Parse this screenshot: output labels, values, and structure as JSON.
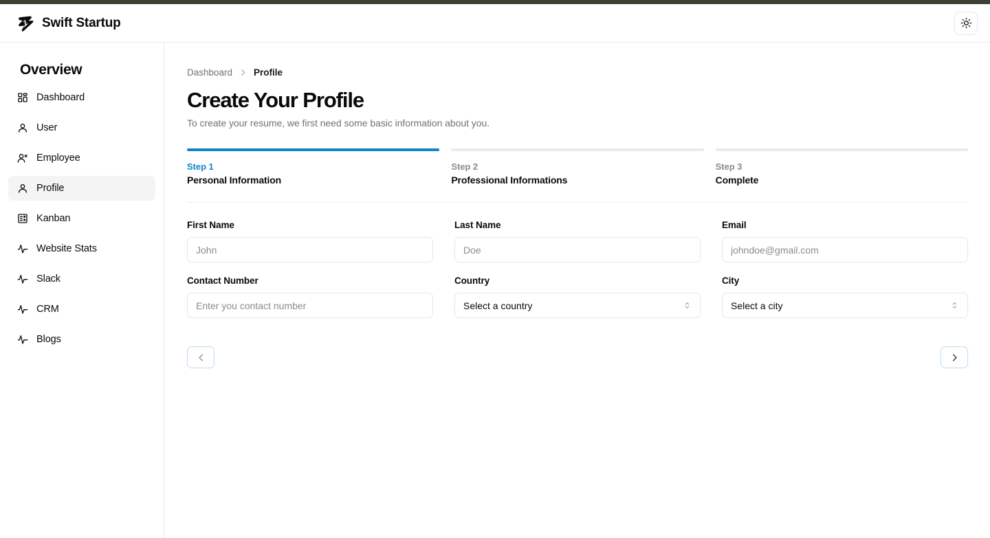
{
  "header": {
    "brand_name": "Swift Startup",
    "logo_icon": "swift-bolt-logo",
    "theme_toggle_icon": "sun-icon"
  },
  "sidebar": {
    "title": "Overview",
    "items": [
      {
        "label": "Dashboard",
        "icon": "layout-grid-icon",
        "active": false
      },
      {
        "label": "User",
        "icon": "user-icon",
        "active": false
      },
      {
        "label": "Employee",
        "icon": "user-x-icon",
        "active": false
      },
      {
        "label": "Profile",
        "icon": "user-icon",
        "active": true
      },
      {
        "label": "Kanban",
        "icon": "kanban-board-icon",
        "active": false
      },
      {
        "label": "Website Stats",
        "icon": "activity-icon",
        "active": false
      },
      {
        "label": "Slack",
        "icon": "activity-icon",
        "active": false
      },
      {
        "label": "CRM",
        "icon": "activity-icon",
        "active": false
      },
      {
        "label": "Blogs",
        "icon": "activity-icon",
        "active": false
      }
    ]
  },
  "breadcrumb": {
    "root": "Dashboard",
    "separator_icon": "chevron-right-icon",
    "current": "Profile"
  },
  "page": {
    "title": "Create Your Profile",
    "subtitle": "To create your resume, we first need some basic information about you."
  },
  "stepper": {
    "active_index": 0,
    "steps": [
      {
        "number": "Step 1",
        "name": "Personal Information"
      },
      {
        "number": "Step 2",
        "name": "Professional Informations"
      },
      {
        "number": "Step 3",
        "name": "Complete"
      }
    ]
  },
  "form": {
    "fields": [
      {
        "label": "First Name",
        "type": "input",
        "value": "",
        "placeholder": "John"
      },
      {
        "label": "Last Name",
        "type": "input",
        "value": "",
        "placeholder": "Doe"
      },
      {
        "label": "Email",
        "type": "input",
        "value": "",
        "placeholder": "johndoe@gmail.com"
      },
      {
        "label": "Contact Number",
        "type": "input",
        "value": "",
        "placeholder": "Enter you contact number"
      },
      {
        "label": "Country",
        "type": "select",
        "value": "Select a country"
      },
      {
        "label": "City",
        "type": "select",
        "value": "Select a city"
      }
    ]
  },
  "form_nav": {
    "prev_label": "Previous step",
    "prev_icon": "chevron-left-icon",
    "next_label": "Next step",
    "next_icon": "chevron-right-icon"
  },
  "colors": {
    "accent": "#1183c9",
    "top_strip": "#3d4135",
    "border": "#e7e7ea",
    "muted_text": "#71717a"
  }
}
